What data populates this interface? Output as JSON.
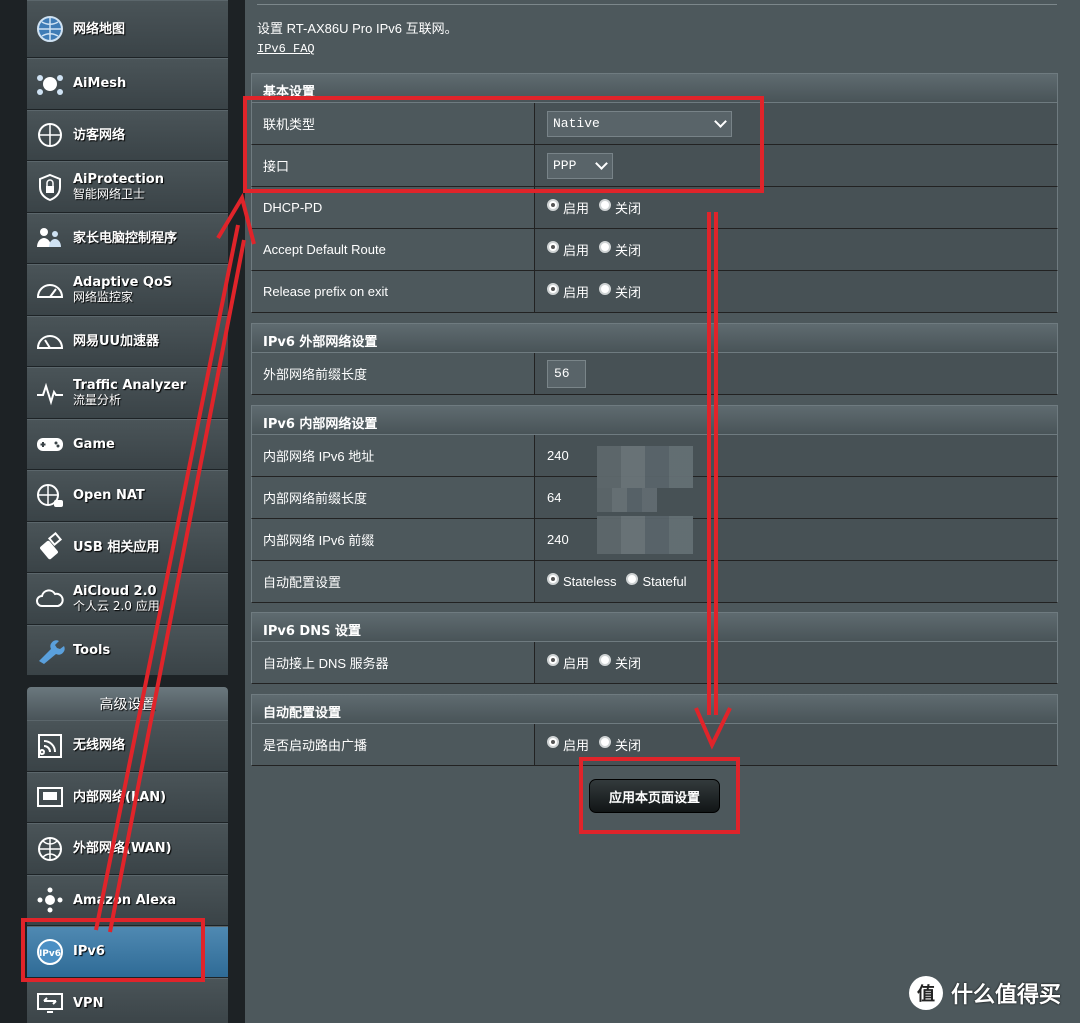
{
  "sidebar": {
    "items": [
      {
        "label": "网络地图",
        "sub": "",
        "icon": "globe-map-icon"
      },
      {
        "label": "AiMesh",
        "sub": "",
        "icon": "mesh-icon"
      },
      {
        "label": "访客网络",
        "sub": "",
        "icon": "guest-globe-icon"
      },
      {
        "label": "AiProtection",
        "sub": "智能网络卫士",
        "icon": "shield-lock-icon"
      },
      {
        "label": "家长电脑控制程序",
        "sub": "",
        "icon": "family-icon"
      },
      {
        "label": "Adaptive QoS",
        "sub": "网络监控家",
        "icon": "speedometer-icon"
      },
      {
        "label": "网易UU加速器",
        "sub": "",
        "icon": "gauge-icon"
      },
      {
        "label": "Traffic Analyzer",
        "sub": "流量分析",
        "icon": "pulse-icon"
      },
      {
        "label": "Game",
        "sub": "",
        "icon": "gamepad-icon"
      },
      {
        "label": "Open NAT",
        "sub": "",
        "icon": "nat-globe-icon"
      },
      {
        "label": "USB 相关应用",
        "sub": "",
        "icon": "usb-icon"
      },
      {
        "label": "AiCloud 2.0",
        "sub": "个人云 2.0 应用",
        "icon": "cloud-icon"
      },
      {
        "label": "Tools",
        "sub": "",
        "icon": "wrench-icon"
      }
    ],
    "advanced_title": "高级设置",
    "advanced_items": [
      {
        "label": "无线网络",
        "icon": "wireless-icon",
        "active": false
      },
      {
        "label": "内部网络(LAN)",
        "icon": "lan-icon",
        "active": false
      },
      {
        "label": "外部网络(WAN)",
        "icon": "wan-globe-icon",
        "active": false
      },
      {
        "label": "Amazon Alexa",
        "icon": "alexa-icon",
        "active": false
      },
      {
        "label": "IPv6",
        "icon": "ipv6-icon",
        "active": true
      },
      {
        "label": "VPN",
        "icon": "vpn-icon",
        "active": false
      }
    ]
  },
  "main": {
    "intro": "设置 RT-AX86U Pro IPv6 互联网。",
    "faq": "IPv6 FAQ",
    "sections": {
      "basic": {
        "title": "基本设置",
        "conn_type_label": "联机类型",
        "conn_type_value": "Native",
        "interface_label": "接口",
        "interface_value": "PPP",
        "dhcp_pd_label": "DHCP-PD",
        "accept_route_label": "Accept Default Route",
        "release_prefix_label": "Release prefix on exit"
      },
      "wan": {
        "title": "IPv6 外部网络设置",
        "prefix_len_label": "外部网络前缀长度",
        "prefix_len_value": "56"
      },
      "lan": {
        "title": "IPv6 内部网络设置",
        "addr_label": "内部网络 IPv6 地址",
        "addr_value": "240",
        "prefix_len_label": "内部网络前缀长度",
        "prefix_len_value": "64",
        "prefix_label": "内部网络 IPv6 前缀",
        "prefix_value": "240",
        "autoconf_label": "自动配置设置",
        "stateless": "Stateless",
        "stateful": "Stateful"
      },
      "dns": {
        "title": "IPv6 DNS 设置",
        "auto_dns_label": "自动接上 DNS 服务器"
      },
      "autoconf": {
        "title": "自动配置设置",
        "router_adv_label": "是否启动路由广播"
      }
    },
    "radio_enable": "启用",
    "radio_disable": "关闭",
    "apply_button": "应用本页面设置"
  },
  "watermark": {
    "logo": "值",
    "text": "什么值得买"
  },
  "colors": {
    "annotation": "#e0242a",
    "active_menu": "#2f6b96"
  }
}
